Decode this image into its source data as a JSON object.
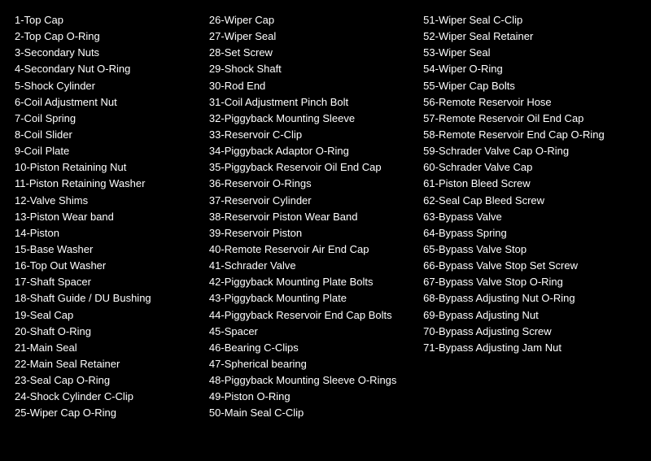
{
  "columns": [
    {
      "id": "col1",
      "items": [
        "1-Top Cap",
        "2-Top Cap O-Ring",
        "3-Secondary Nuts",
        "4-Secondary Nut O-Ring",
        "5-Shock Cylinder",
        "6-Coil Adjustment Nut",
        "7-Coil Spring",
        "8-Coil Slider",
        "9-Coil Plate",
        "10-Piston Retaining Nut",
        "11-Piston Retaining Washer",
        "12-Valve Shims",
        "13-Piston Wear band",
        "14-Piston",
        "15-Base Washer",
        "16-Top Out Washer",
        "17-Shaft Spacer",
        "18-Shaft Guide / DU Bushing",
        "19-Seal Cap",
        "20-Shaft O-Ring",
        "21-Main Seal",
        "22-Main Seal Retainer",
        "23-Seal Cap O-Ring",
        "24-Shock Cylinder C-Clip",
        "25-Wiper Cap O-Ring"
      ]
    },
    {
      "id": "col2",
      "items": [
        "26-Wiper Cap",
        "27-Wiper Seal",
        "28-Set Screw",
        "29-Shock Shaft",
        "30-Rod End",
        "31-Coil Adjustment Pinch Bolt",
        "32-Piggyback Mounting Sleeve",
        "33-Reservoir C-Clip",
        "34-Piggyback Adaptor O-Ring",
        "35-Piggyback Reservoir Oil End Cap",
        "36-Reservoir O-Rings",
        "37-Reservoir Cylinder",
        "38-Reservoir Piston Wear Band",
        "39-Reservoir Piston",
        "40-Remote Reservoir Air End Cap",
        "41-Schrader Valve",
        "42-Piggyback Mounting Plate Bolts",
        "43-Piggyback Mounting Plate",
        "44-Piggyback Reservoir End Cap Bolts",
        "45-Spacer",
        "46-Bearing C-Clips",
        "47-Spherical bearing",
        "48-Piggyback Mounting Sleeve O-Rings",
        "49-Piston O-Ring",
        "50-Main Seal C-Clip"
      ]
    },
    {
      "id": "col3",
      "items": [
        "51-Wiper Seal C-Clip",
        "52-Wiper Seal Retainer",
        "53-Wiper Seal",
        "54-Wiper O-Ring",
        "55-Wiper Cap Bolts",
        "56-Remote Reservoir Hose",
        "57-Remote Reservoir Oil End Cap",
        "58-Remote Reservoir End Cap O-Ring",
        "59-Schrader Valve Cap O-Ring",
        "60-Schrader Valve Cap",
        "61-Piston Bleed Screw",
        "62-Seal Cap Bleed Screw",
        "63-Bypass Valve",
        "64-Bypass Spring",
        "65-Bypass Valve Stop",
        "66-Bypass Valve Stop Set Screw",
        "67-Bypass Valve Stop O-Ring",
        "68-Bypass Adjusting Nut O-Ring",
        "69-Bypass Adjusting Nut",
        "70-Bypass Adjusting Screw",
        "71-Bypass Adjusting Jam Nut"
      ]
    }
  ]
}
